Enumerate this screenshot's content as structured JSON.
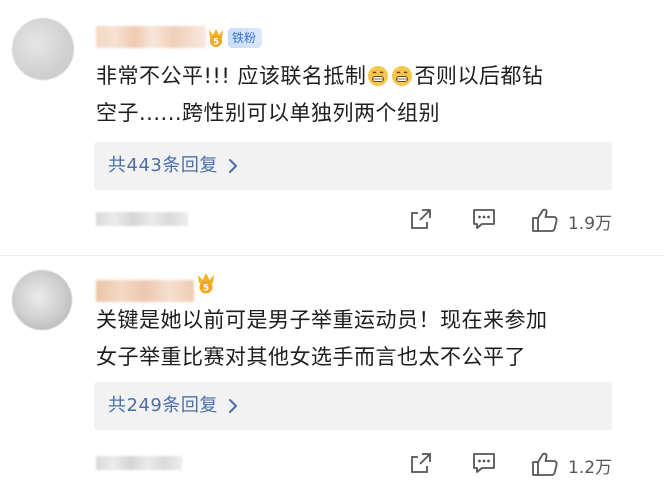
{
  "comments": [
    {
      "fan_badge": "铁粉",
      "text_line1": "非常不公平!!! 应该联名抵制",
      "text_line2": "否则以后都钻",
      "text_line3": "空子......跨性别可以单独列两个组别",
      "emojis": [
        "grinning-grimace-icon",
        "grinning-grimace-icon"
      ],
      "replies_label": "共443条回复",
      "likes": "1.9万"
    },
    {
      "text_line1": "关键是她以前可是男子举重运动员！现在来参加",
      "text_line2": "女子举重比赛对其他女选手而言也太不公平了",
      "replies_label": "共249条回复",
      "likes": "1.2万"
    }
  ],
  "colors": {
    "reply_link": "#4a6fa5",
    "badge_text": "#3b73c8",
    "medal": "#f0a81c"
  }
}
